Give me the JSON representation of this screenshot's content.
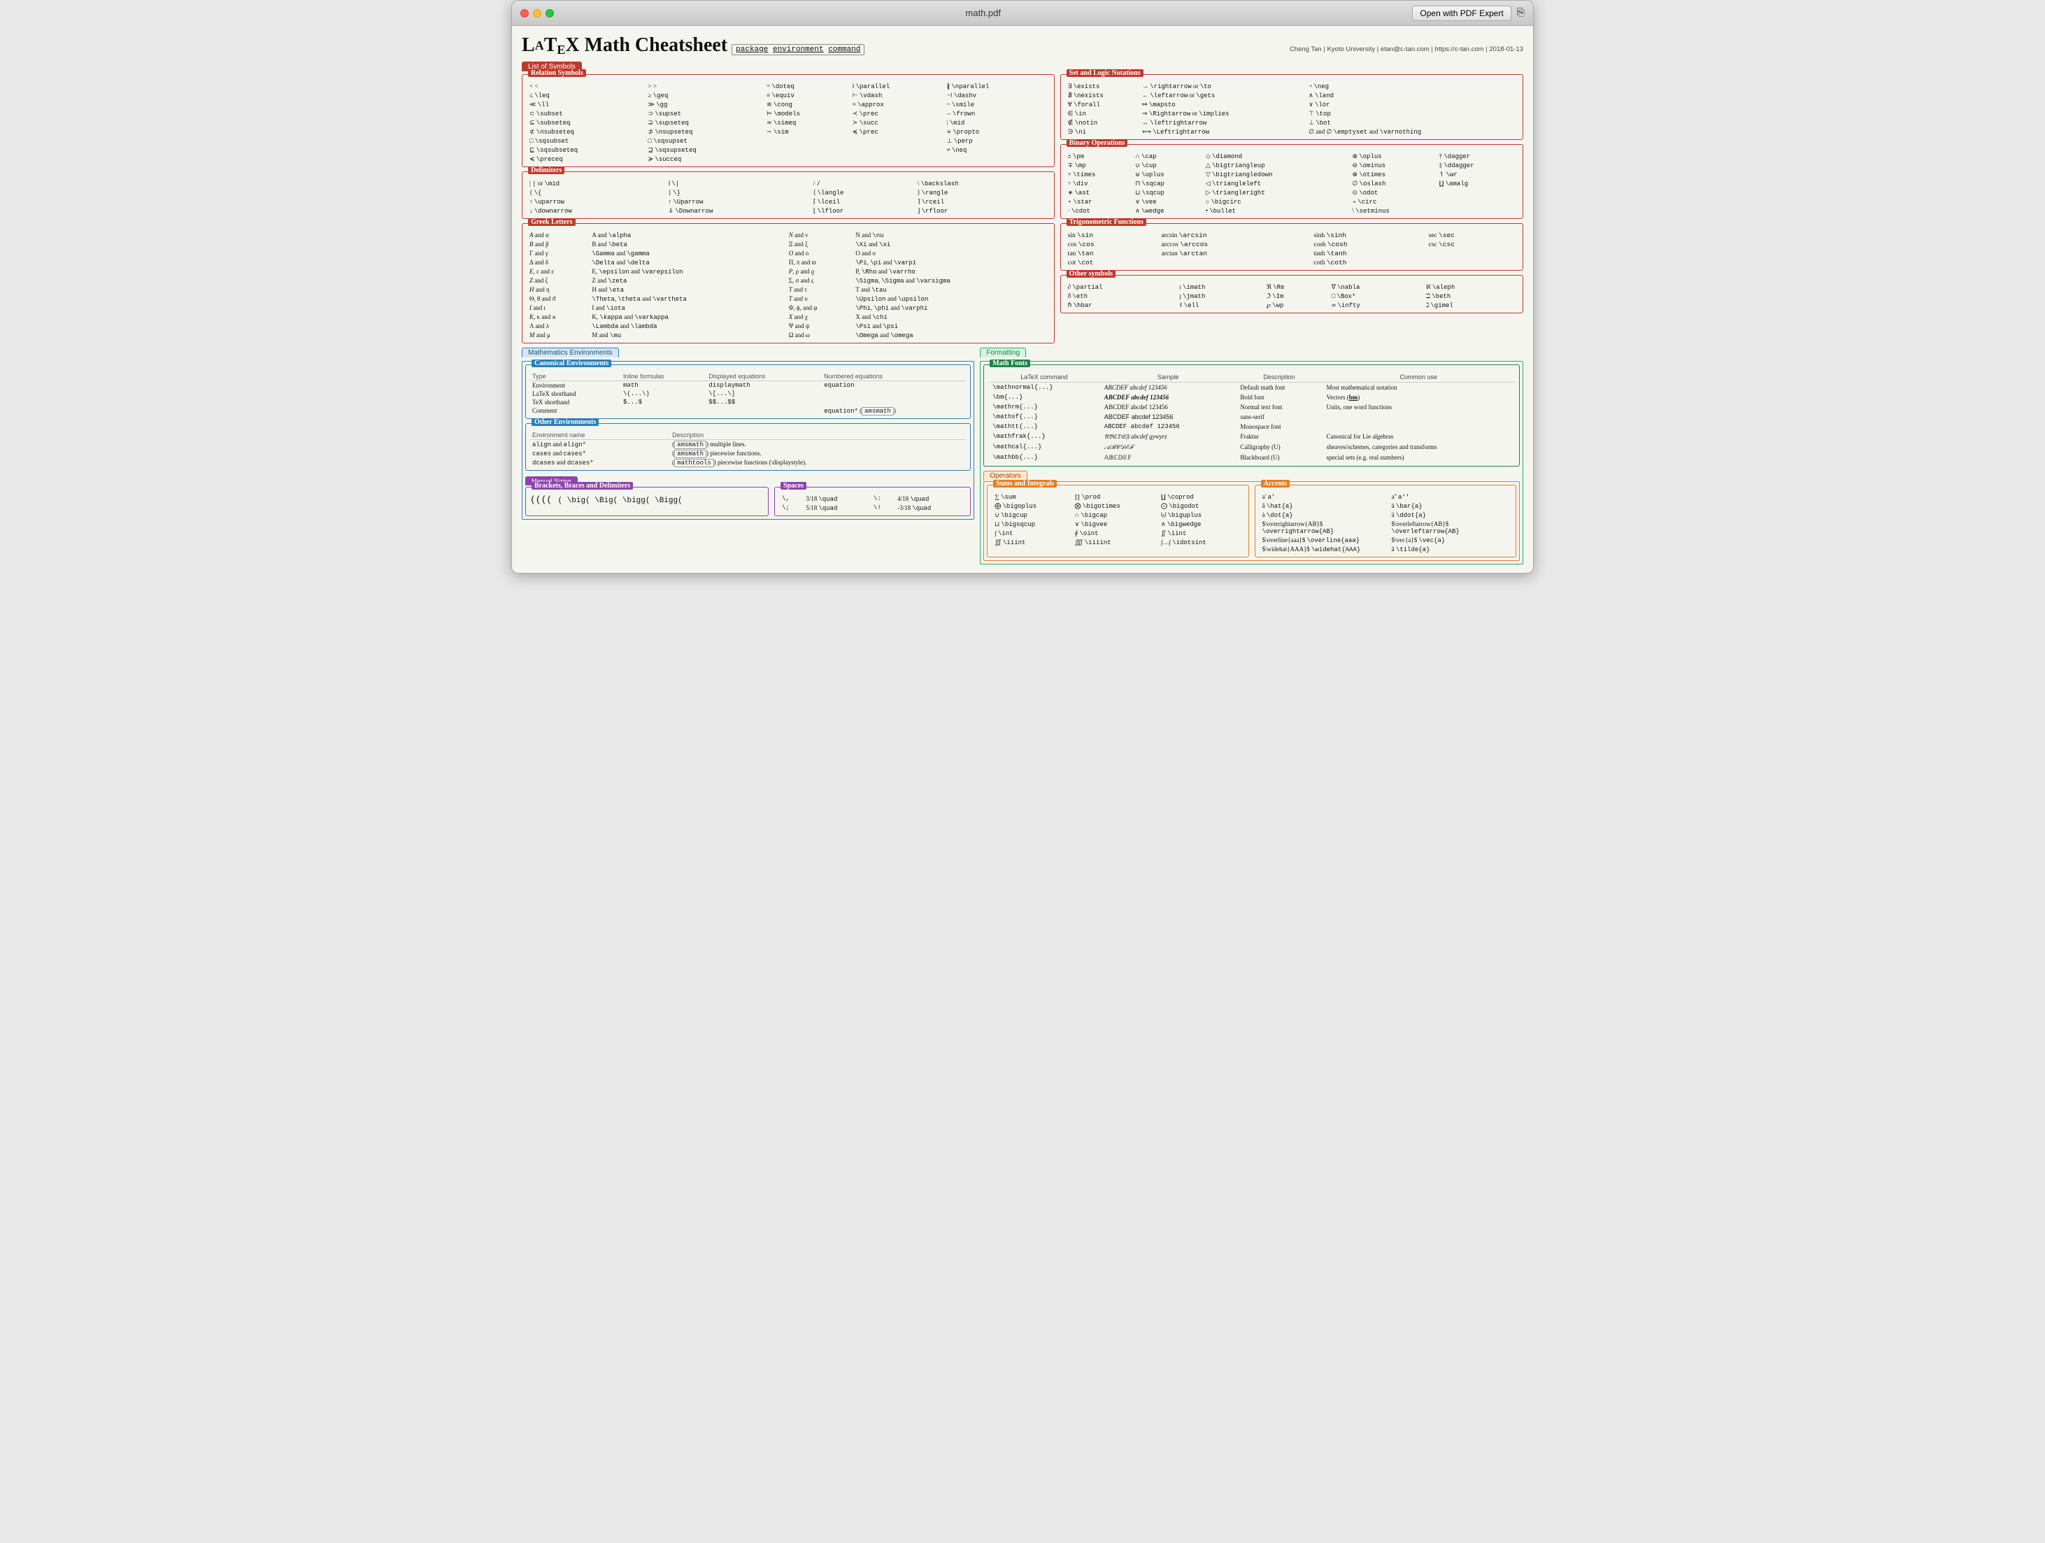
{
  "window": {
    "title": "math.pdf",
    "open_button": "Open with PDF Expert"
  },
  "page": {
    "title": "LaTeX Math Cheatsheet",
    "header_package": "package",
    "header_env": "environment",
    "header_cmd": "command",
    "author": "Cheng Tan | Kyoto University | etan@c-tan.com | https://c-tan.com | 2018-01-13"
  }
}
